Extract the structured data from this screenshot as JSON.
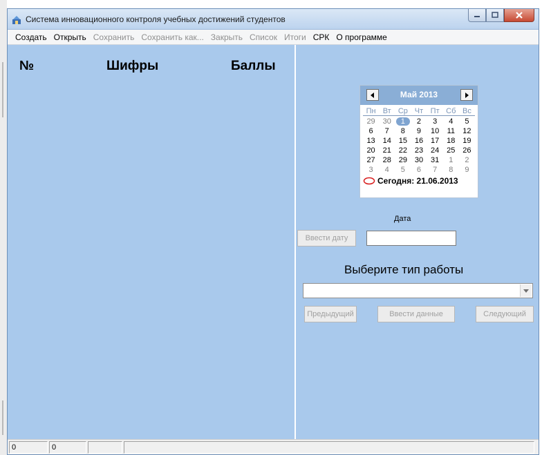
{
  "window": {
    "title": "Система инновационного контроля учебных достижений студентов"
  },
  "menu": [
    {
      "label": "Создать",
      "enabled": true
    },
    {
      "label": "Открыть",
      "enabled": true
    },
    {
      "label": "Сохранить",
      "enabled": false
    },
    {
      "label": "Сохранить как...",
      "enabled": false
    },
    {
      "label": "Закрыть",
      "enabled": false
    },
    {
      "label": "Список",
      "enabled": false
    },
    {
      "label": "Итоги",
      "enabled": false
    },
    {
      "label": "СРК",
      "enabled": true
    },
    {
      "label": "О программе",
      "enabled": true
    }
  ],
  "grid_headers": {
    "number": "№",
    "codes": "Шифры",
    "scores": "Баллы"
  },
  "calendar": {
    "month_title": "Май 2013",
    "weekdays": [
      "Пн",
      "Вт",
      "Ср",
      "Чт",
      "Пт",
      "Сб",
      "Вс"
    ],
    "weeks": [
      [
        "29",
        "30",
        "1",
        "2",
        "3",
        "4",
        "5"
      ],
      [
        "6",
        "7",
        "8",
        "9",
        "10",
        "11",
        "12"
      ],
      [
        "13",
        "14",
        "15",
        "16",
        "17",
        "18",
        "19"
      ],
      [
        "20",
        "21",
        "22",
        "23",
        "24",
        "25",
        "26"
      ],
      [
        "27",
        "28",
        "29",
        "30",
        "31",
        "1",
        "2"
      ],
      [
        "3",
        "4",
        "5",
        "6",
        "7",
        "8",
        "9"
      ]
    ],
    "selected_day": "1",
    "today_label": "Сегодня: 21.06.2013"
  },
  "date_section": {
    "label": "Дата",
    "enter_button": "Ввести дату",
    "input_value": ""
  },
  "work_type": {
    "title": "Выберите тип работы",
    "selected_value": ""
  },
  "buttons": {
    "previous": "Предыдущий",
    "enter_data": "Ввести данные",
    "next": "Следующий"
  },
  "statusbar": {
    "panel1": "0",
    "panel2": "0",
    "panel3": ""
  },
  "colors": {
    "panel_bg": "#a9c9ec",
    "calendar_header": "#8aaed6",
    "today_circle": "#d81e1e"
  }
}
